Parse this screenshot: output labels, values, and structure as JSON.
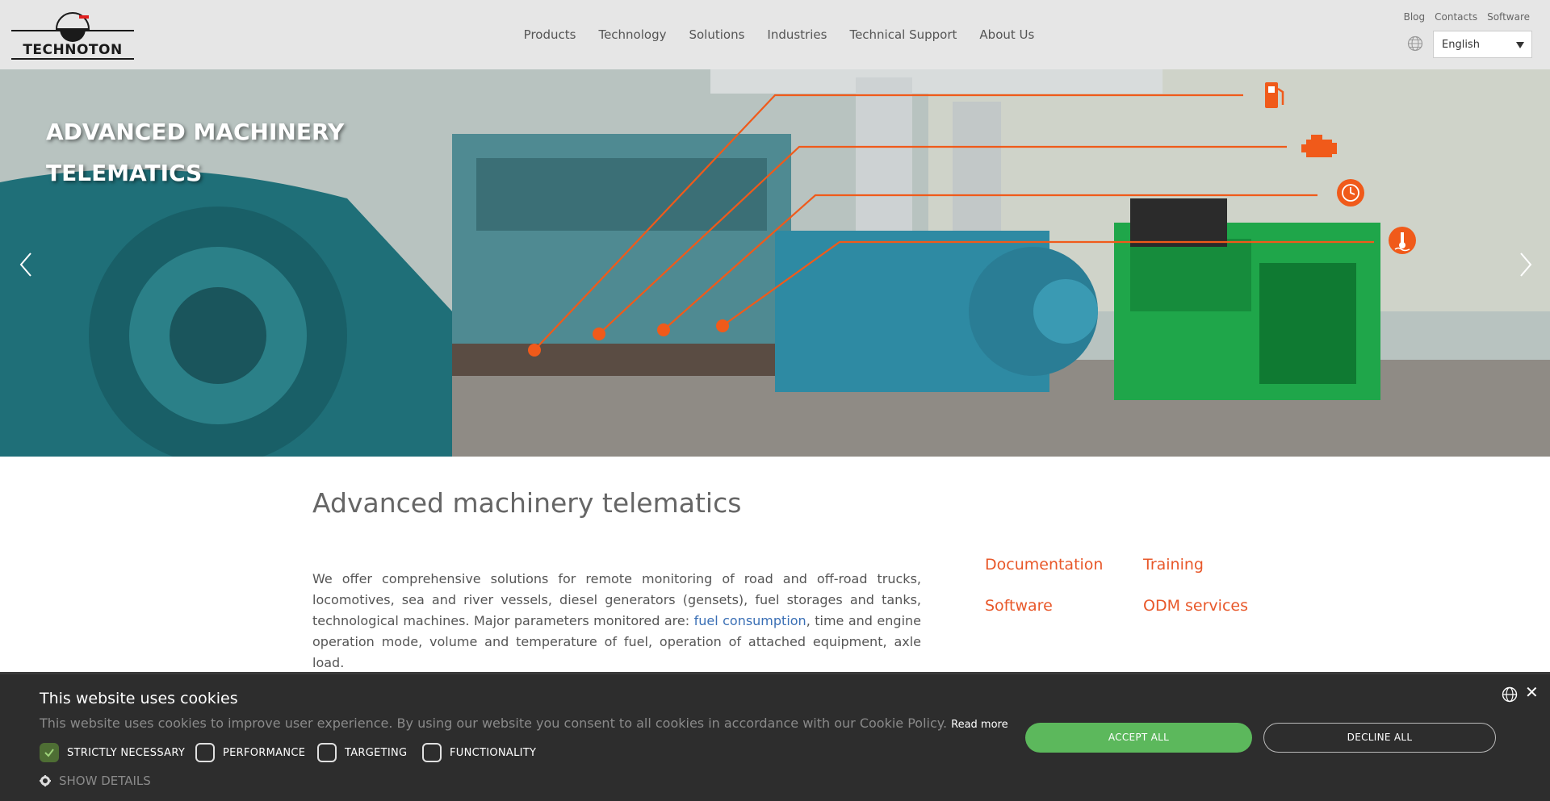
{
  "logo": {
    "text": "TECHNOTON"
  },
  "nav": {
    "items": [
      "Products",
      "Technology",
      "Solutions",
      "Industries",
      "Technical Support",
      "About Us"
    ]
  },
  "top_links": [
    "Blog",
    "Contacts",
    "Software"
  ],
  "language": {
    "selected": "English"
  },
  "hero": {
    "title_line1": "ADVANCED MACHINERY",
    "title_line2": "TELEMATICS",
    "icons": [
      "fuel-pump-icon",
      "engine-icon",
      "clock-icon",
      "temperature-icon"
    ],
    "accent_color": "#f05a1a"
  },
  "main": {
    "title": "Advanced machinery telematics",
    "intro_before_link": "We offer comprehensive solutions for remote monitoring of road and off-road trucks, locomotives, sea and river vessels, diesel generators (gensets), fuel storages and tanks, technological machines. Major parameters monitored are: ",
    "intro_link": "fuel consumption",
    "intro_after_link": ", time and engine operation mode, volume and temperature of fuel, operation of attached equipment, axle load.",
    "side_links": [
      "Documentation",
      "Training",
      "Software",
      "ODM services"
    ],
    "side_link_color": "#e8582a"
  },
  "cookie": {
    "title": "This website uses cookies",
    "description": "This website uses cookies to improve user experience. By using our website you consent to all cookies in accordance with our Cookie Policy.",
    "read_more": "Read more",
    "options": [
      {
        "label": "STRICTLY NECESSARY",
        "checked": true
      },
      {
        "label": "PERFORMANCE",
        "checked": false
      },
      {
        "label": "TARGETING",
        "checked": false
      },
      {
        "label": "FUNCTIONALITY",
        "checked": false
      }
    ],
    "show_details": "SHOW DETAILS",
    "accept_label": "ACCEPT ALL",
    "decline_label": "DECLINE ALL",
    "close_glyph": "✕"
  }
}
